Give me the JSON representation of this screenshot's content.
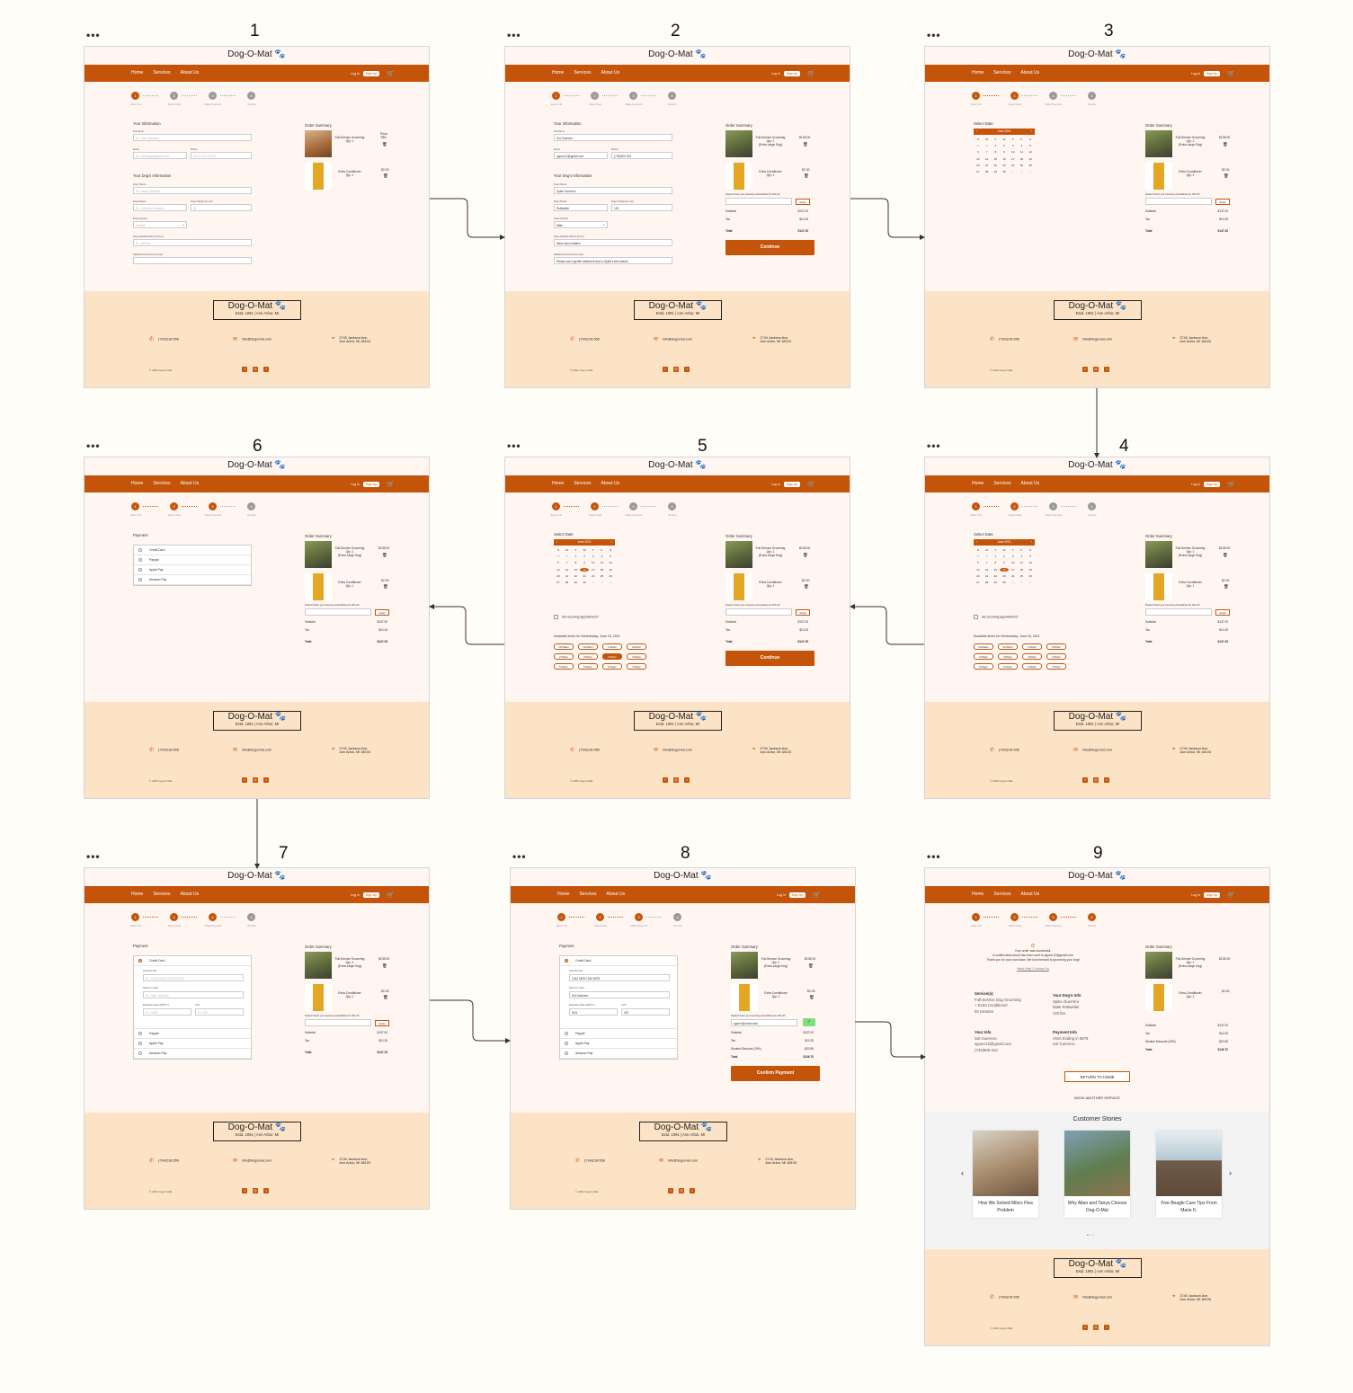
{
  "nav": {
    "logo": "Dog-O-Mat",
    "links": [
      "Home",
      "Services",
      "About Us"
    ],
    "login": "Log In",
    "signup": "Sign Up"
  },
  "steps": [
    "Enter Info",
    "Select Date",
    "Make Payment",
    "Review"
  ],
  "frame_numbers": [
    "1",
    "2",
    "3",
    "4",
    "5",
    "6",
    "7",
    "8",
    "9"
  ],
  "frame_dots": "•••",
  "form": {
    "your_info_title": "Your Information",
    "dog_info_title": "Your Dog's Information",
    "labels": {
      "full_name": "Full Name",
      "email": "Email",
      "phone": "Phone",
      "dog_name": "Dog's Name",
      "dog_breed": "Dog's Breed",
      "dog_weight": "Dog's Weight (in Lbs)",
      "dog_gender": "Dog's Gender",
      "dog_medical": "Dog's Medical History (if Any)",
      "comments": "Additional Comments (if any)"
    },
    "placeholders": {
      "full_name": "Ex. Sam Labrador",
      "email": "Ex. labradogs@gmail.com",
      "phone": "(XXX) XXX-XXXX",
      "dog_name": "Ex. Daisy Labrador",
      "dog_breed": "Ex. Labrador Retriever",
      "dog_weight": "50",
      "dog_gender": "Female",
      "dog_medical": "Ex. Arthritis"
    },
    "values": {
      "full_name": "Sol Guerrero",
      "email": "sguerr12@gmail.com",
      "phone": "(734)500-312",
      "dog_name": "Spike Guerrero",
      "dog_breed": "Rottweiler",
      "dog_weight": "120",
      "dog_gender": "Male",
      "dog_medical": "Minor skin irritation",
      "comments": "Please use a gentle treatment due to Spike's skin issues."
    }
  },
  "summary": {
    "title": "Order Summary",
    "item1": {
      "name": "Full-Service Grooming",
      "qty": "Qty: 1",
      "size": "(Extra-Large Dog)",
      "price": "$135.00",
      "price_pending": "Price TBD"
    },
    "item2": {
      "name": "Extra Conditioner",
      "qty": "Qty: 1",
      "price": "$2.00"
    },
    "promo_label": "Student? Enter your university email address for 15% off!",
    "promo_value": "sguerr@umich.edu",
    "apply": "Apply",
    "subtotal_label": "Subtotal",
    "subtotal": "$137.00",
    "tax_label": "Tax",
    "tax": "$10.25",
    "discount_label": "Student Discount (15%)",
    "discount": "-$20.55",
    "total_label": "Total",
    "total": "$147.25",
    "total_discounted": "$126.70",
    "continue": "Continue",
    "confirm": "Confirm Payment"
  },
  "calendar": {
    "title": "Select Date",
    "month": "June 2021",
    "dow": [
      "S",
      "M",
      "T",
      "W",
      "T",
      "F",
      "S"
    ],
    "days": [
      "30",
      "31",
      "1",
      "2",
      "3",
      "4",
      "5",
      "6",
      "7",
      "8",
      "9",
      "10",
      "11",
      "12",
      "13",
      "14",
      "15",
      "16",
      "17",
      "18",
      "19",
      "20",
      "21",
      "22",
      "23",
      "24",
      "25",
      "26",
      "27",
      "28",
      "29",
      "30",
      "1",
      "2",
      "3"
    ],
    "recurring": "Set recurring appointment?",
    "avail_title": "Available times for Wednesday, June 16, 2021",
    "times": [
      "10:00am",
      "12:00pm",
      "1:00pm",
      "2:00pm",
      "2:30pm",
      "3:00pm",
      "4:00pm",
      "4:30pm",
      "5:00pm",
      "6:00pm",
      "6:30pm",
      "7:00pm"
    ]
  },
  "payment": {
    "title": "Payment",
    "options": [
      "Credit Card",
      "Paypal",
      "Apple Pay",
      "Amazon Pay"
    ],
    "card_label": "Card Number",
    "card_ph": "Ex. XXXX-XXXX-XXXX-XXXX",
    "card_val": "1234 5678 1234 5678",
    "name_label": "Name on Card",
    "name_ph": "Ex. Sam Labrador",
    "name_val": "Sol Guerrero",
    "exp_label": "Expiration Date (MM/YY)",
    "exp_ph": "Ex. 10/26",
    "exp_val": "9/24",
    "cvv_label": "CVV",
    "cvv_ph": "Ex. 123",
    "cvv_val": "421"
  },
  "review": {
    "success": "Your order was successful.",
    "email_note": "A confirmation email has been sent to sguerr12@gmail.com",
    "thanks": "Thank you for your purchase. We look forward to grooming your dog!",
    "help": "Need Help? Contact Us",
    "services_title": "Service(s)",
    "services": [
      "Full-Service Dog Grooming",
      "+ Extra Conditioner",
      "60 minutes"
    ],
    "dog_title": "Your Dog's Info",
    "dog": [
      "Spike Guerrero",
      "Male Rottweiler",
      "120 lbs"
    ],
    "info_title": "Your Info",
    "info": [
      "Sol Guerrero",
      "sguerr12@gmail.com",
      "(734)500-312"
    ],
    "pay_title": "Payment Info",
    "pay": [
      "VISA Ending in 5678",
      "Sol Guerrero"
    ],
    "return_home": "RETURN TO HOME",
    "book_another": "BOOK ANOTHER SERVICE",
    "stories_title": "Customer Stories",
    "stories": [
      "How We Solved Mila's Flea Problem",
      "Why Altair and Tanya Choose Dog-O-Mat",
      "Five Beagle Care Tips From Marie K."
    ]
  },
  "footer": {
    "logo": "Dog-O-Mat",
    "sub": "Estd. 1991 | Ann Arbor, MI",
    "phone": "(734)218-556",
    "email": "info@dogomat.com",
    "address1": "2740 Jackson Ave,",
    "address2": "Ann Arbor, MI 48103",
    "copy": "© 2021 Dog-O-Mat"
  },
  "colors": {
    "accent": "#c4540a",
    "footer_bg": "#fde3c6",
    "page_bg": "#fff5f1"
  },
  "icons": [
    "paw-icon",
    "cart-icon",
    "trash-icon",
    "phone-icon",
    "mail-icon",
    "location-icon",
    "facebook-icon",
    "instagram-icon",
    "twitter-icon",
    "check-icon",
    "chevron-left-icon",
    "chevron-right-icon"
  ]
}
